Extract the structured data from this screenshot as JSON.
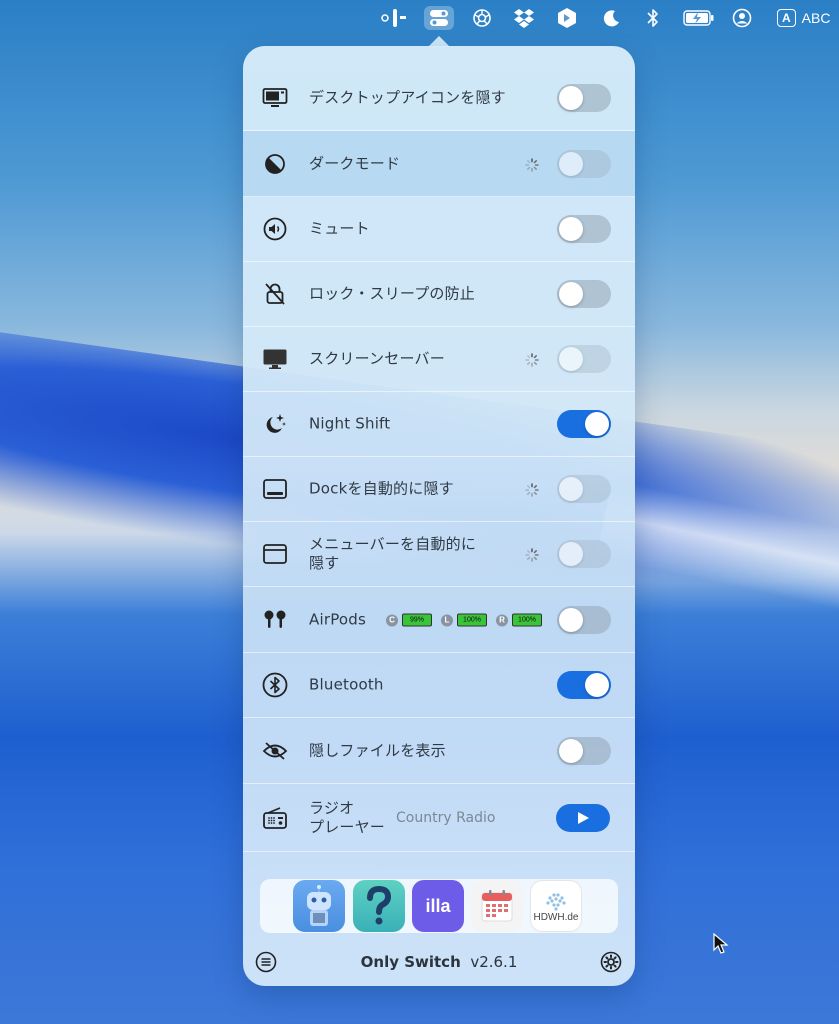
{
  "menubar": {
    "items": [
      {
        "icon": "onlyswitch-icon"
      },
      {
        "icon": "toggles-icon",
        "active": true
      },
      {
        "icon": "chatgpt-icon"
      },
      {
        "icon": "dropbox-icon"
      },
      {
        "icon": "hexagon-app-icon"
      },
      {
        "icon": "moon-icon"
      },
      {
        "icon": "bluetooth-icon"
      },
      {
        "icon": "battery-charging-icon"
      },
      {
        "icon": "user-account-icon"
      }
    ],
    "input_source_letter": "A",
    "input_source_label": "ABC"
  },
  "panel": {
    "rows": [
      {
        "icon": "display-icon",
        "label": "デスクトップアイコンを隠す",
        "state": "off",
        "loading": false
      },
      {
        "icon": "dark-mode-icon",
        "label": "ダークモード",
        "state": "off",
        "loading": true,
        "highlighted": true
      },
      {
        "icon": "speaker-icon",
        "label": "ミュート",
        "state": "off",
        "loading": false
      },
      {
        "icon": "lock-slash-icon",
        "label": "ロック・スリープの防止",
        "state": "off",
        "loading": false
      },
      {
        "icon": "monitor-icon",
        "label": "スクリーンセーバー",
        "state": "off",
        "loading": true
      },
      {
        "icon": "moon-stars-icon",
        "label": "Night Shift",
        "state": "on",
        "loading": false
      },
      {
        "icon": "dock-icon",
        "label": "Dockを自動的に隠す",
        "state": "off",
        "loading": true
      },
      {
        "icon": "window-icon",
        "label_line1": "メニューバーを自動的に",
        "label_line2": "隠す",
        "state": "off",
        "loading": true
      },
      {
        "icon": "airpods-icon",
        "label": "AirPods",
        "state": "off",
        "loading": false,
        "batteries": [
          {
            "letter": "C",
            "percent": "99%",
            "level": 0.99
          },
          {
            "letter": "L",
            "percent": "100%",
            "level": 1.0
          },
          {
            "letter": "R",
            "percent": "100%",
            "level": 1.0
          }
        ]
      },
      {
        "icon": "bluetooth-icon",
        "label": "Bluetooth",
        "state": "on",
        "loading": false
      },
      {
        "icon": "eye-slash-icon",
        "label": "隠しファイルを表示",
        "state": "off",
        "loading": false
      },
      {
        "icon": "radio-icon",
        "label_line1": "ラジオ",
        "label_line2": "プレーヤー",
        "station": "Country Radio",
        "control": "play"
      }
    ],
    "apps": [
      {
        "name": "robot-app-icon"
      },
      {
        "name": "question-app-icon"
      },
      {
        "name": "illa-app-icon",
        "text": "illa"
      },
      {
        "name": "calendar-app-icon"
      },
      {
        "name": "hdwh-app-icon",
        "text": "HDWH.de"
      }
    ],
    "footer": {
      "app_name": "Only Switch",
      "version": "v2.6.1"
    }
  },
  "colors": {
    "accent": "#1a6fe0",
    "toggle_off": "#96a5b4",
    "battery_green": "#3ac43a"
  }
}
